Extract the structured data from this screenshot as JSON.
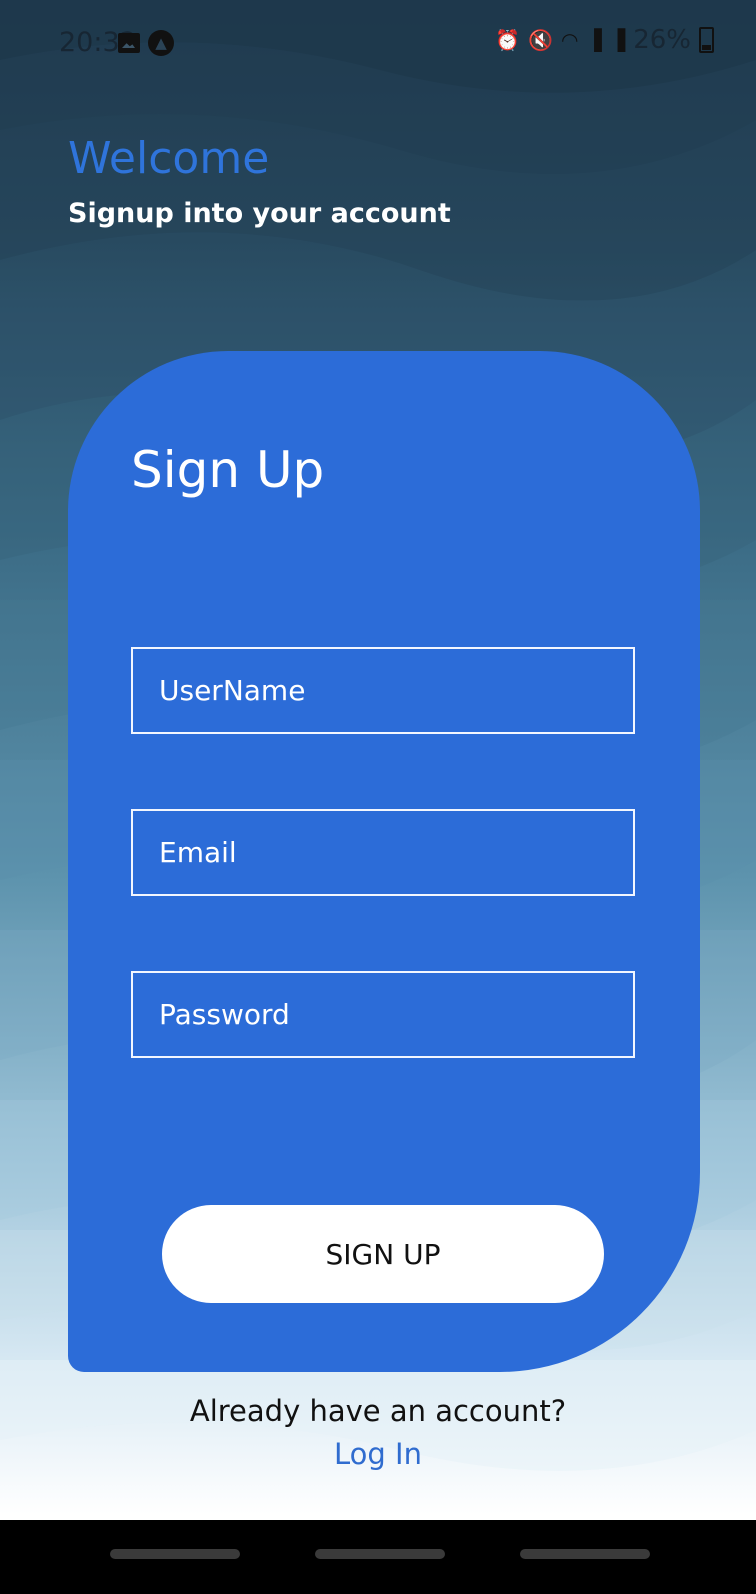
{
  "status_bar": {
    "time": "20:32",
    "battery_text": "26%",
    "icons": [
      "image-icon",
      "app-icon",
      "alarm-icon",
      "mute-icon",
      "wifi-icon",
      "signal-icon",
      "signal-icon",
      "battery-icon"
    ]
  },
  "header": {
    "title": "Welcome",
    "subtitle": "Signup into your account"
  },
  "form": {
    "title": "Sign Up",
    "username_placeholder": "UserName",
    "email_placeholder": "Email",
    "password_placeholder": "Password",
    "submit_label": "SIGN UP"
  },
  "footer": {
    "prompt": "Already have an account?",
    "login_link": "Log In"
  },
  "colors": {
    "accent": "#2c6cd8",
    "title_blue": "#2f74db",
    "link_blue": "#2f6ccf",
    "background_top": "#203a4f",
    "background_bottom": "#ffffff"
  }
}
